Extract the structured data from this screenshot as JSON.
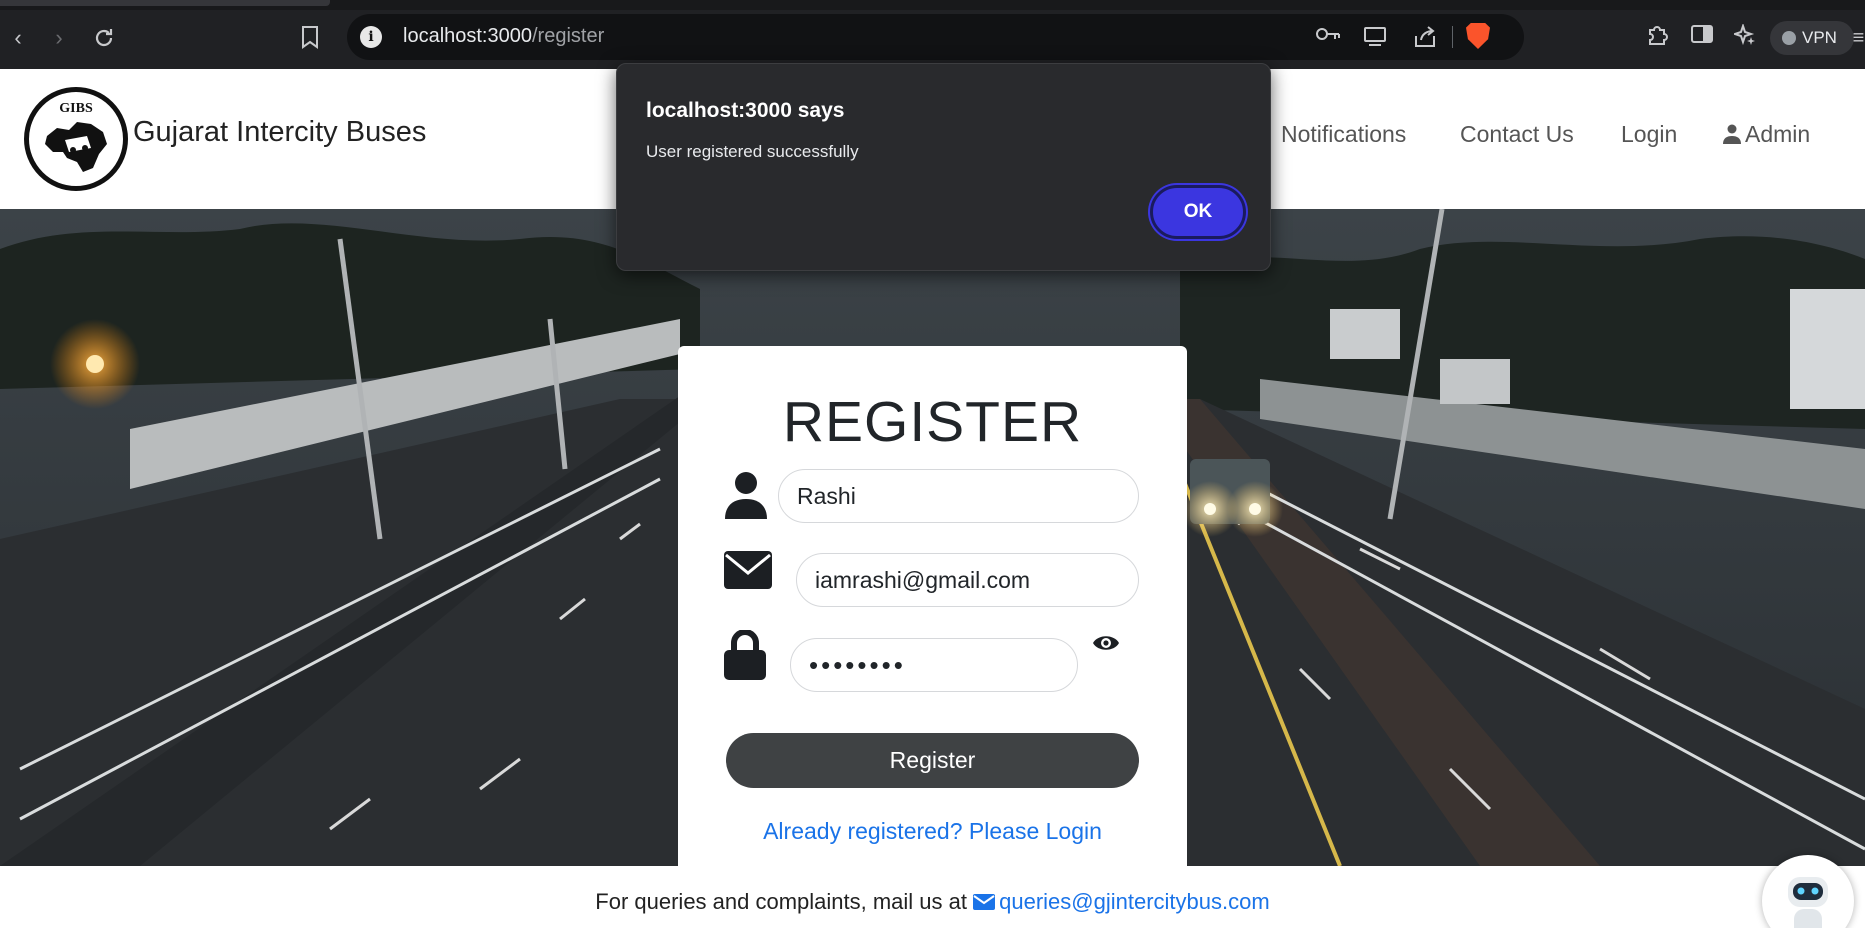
{
  "browser": {
    "url_host": "localhost:3000",
    "url_path": "/register",
    "vpn_label": "VPN",
    "icons": [
      "back-icon",
      "forward-icon",
      "reload-icon",
      "bookmark-icon",
      "site-info-icon",
      "key-icon",
      "cast-icon",
      "share-icon",
      "brave-shield-icon",
      "extensions-icon",
      "sidebar-icon",
      "leo-ai-icon",
      "menu-icon"
    ]
  },
  "header": {
    "logo_text": "GIBS",
    "brand": "Gujarat Intercity Buses",
    "nav": {
      "notifications": "Notifications",
      "contact": "Contact Us",
      "login": "Login",
      "admin": "Admin"
    }
  },
  "form": {
    "title": "REGISTER",
    "name_value": "Rashi",
    "email_value": "iamrashi@gmail.com",
    "password_value": "••••••••",
    "submit_label": "Register",
    "login_link": "Already registered? Please Login"
  },
  "footer": {
    "text": "For queries and complaints, mail us at",
    "email": "queries@gjintercitybus.com"
  },
  "dialog": {
    "title": "localhost:3000 says",
    "message": "User registered successfully",
    "ok_label": "OK"
  },
  "colors": {
    "dialog_bg": "#292a2d",
    "ok_button": "#3b36e0",
    "link": "#1a73e8",
    "register_button": "#3f4244"
  }
}
